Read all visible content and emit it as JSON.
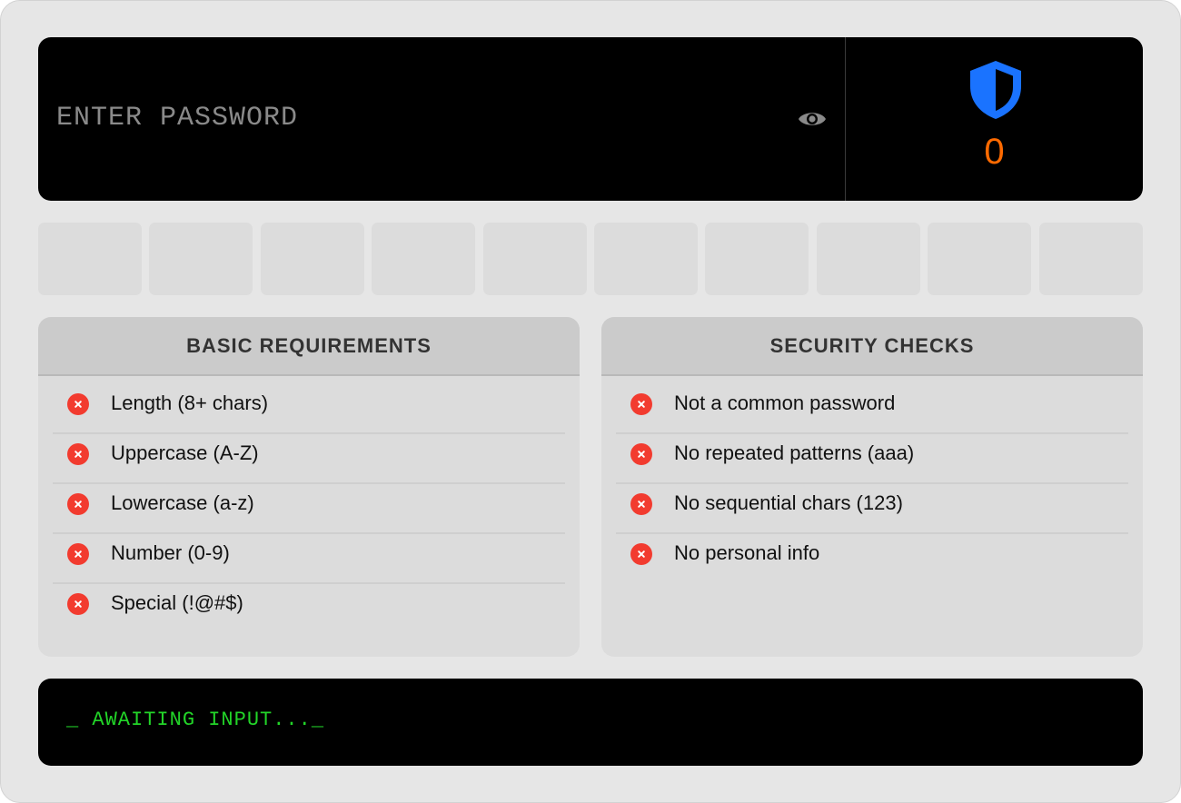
{
  "password": {
    "placeholder": "ENTER PASSWORD",
    "value": ""
  },
  "score": {
    "value": "0",
    "color": "#ff6a00",
    "shield_color": "#1a73ff"
  },
  "strength_meter": {
    "segments": 10,
    "filled": 0
  },
  "basic_requirements": {
    "title": "BASIC REQUIREMENTS",
    "items": [
      {
        "label": "Length (8+ chars)",
        "status": "fail"
      },
      {
        "label": "Uppercase (A-Z)",
        "status": "fail"
      },
      {
        "label": "Lowercase (a-z)",
        "status": "fail"
      },
      {
        "label": "Number (0-9)",
        "status": "fail"
      },
      {
        "label": "Special (!@#$)",
        "status": "fail"
      }
    ]
  },
  "security_checks": {
    "title": "SECURITY CHECKS",
    "items": [
      {
        "label": "Not a common password",
        "status": "fail"
      },
      {
        "label": "No repeated patterns (aaa)",
        "status": "fail"
      },
      {
        "label": "No sequential chars (123)",
        "status": "fail"
      },
      {
        "label": "No personal info",
        "status": "fail"
      }
    ]
  },
  "console": {
    "text": "_ AWAITING INPUT..._"
  },
  "colors": {
    "fail": "#f23b2f",
    "console_text": "#22d428"
  },
  "icons": {
    "visibility": "eye-icon",
    "score": "shield-icon",
    "fail": "x-circle-icon"
  }
}
